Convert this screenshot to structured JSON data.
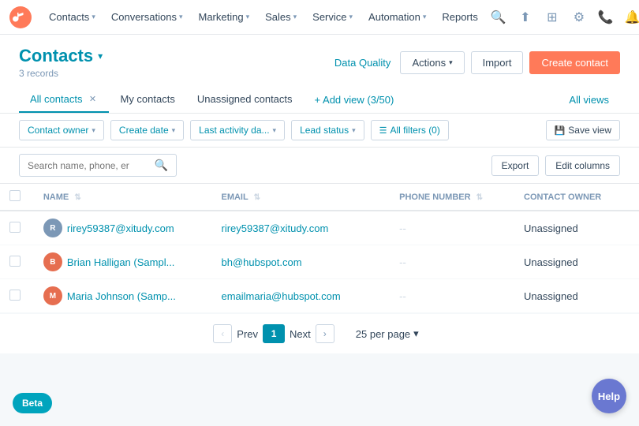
{
  "topnav": {
    "logo_alt": "HubSpot",
    "items": [
      {
        "label": "Contacts",
        "id": "contacts"
      },
      {
        "label": "Conversations",
        "id": "conversations"
      },
      {
        "label": "Marketing",
        "id": "marketing"
      },
      {
        "label": "Sales",
        "id": "sales"
      },
      {
        "label": "Service",
        "id": "service"
      },
      {
        "label": "Automation",
        "id": "automation"
      },
      {
        "label": "Reports",
        "id": "reports"
      }
    ],
    "icons": [
      "search",
      "upgrade",
      "apps",
      "settings",
      "calls",
      "notifications"
    ]
  },
  "page": {
    "title": "Contacts",
    "records_count": "3 records",
    "data_quality_label": "Data Quality",
    "actions_label": "Actions",
    "import_label": "Import",
    "create_contact_label": "Create contact"
  },
  "tabs": [
    {
      "label": "All contacts",
      "active": true,
      "closeable": true,
      "id": "all-contacts"
    },
    {
      "label": "My contacts",
      "active": false,
      "closeable": false,
      "id": "my-contacts"
    },
    {
      "label": "Unassigned contacts",
      "active": false,
      "closeable": false,
      "id": "unassigned-contacts"
    }
  ],
  "add_view": "+ Add view (3/50)",
  "all_views": "All views",
  "filters": [
    {
      "label": "Contact owner",
      "id": "contact-owner"
    },
    {
      "label": "Create date",
      "id": "create-date"
    },
    {
      "label": "Last activity da...",
      "id": "last-activity"
    },
    {
      "label": "Lead status",
      "id": "lead-status"
    },
    {
      "label": "All filters (0)",
      "id": "all-filters",
      "icon": "filter"
    }
  ],
  "save_view_label": "Save view",
  "search": {
    "placeholder": "Search name, phone, er"
  },
  "toolbar": {
    "export_label": "Export",
    "edit_columns_label": "Edit columns"
  },
  "table": {
    "columns": [
      {
        "label": "NAME",
        "id": "name",
        "sortable": true
      },
      {
        "label": "EMAIL",
        "id": "email",
        "sortable": true
      },
      {
        "label": "PHONE NUMBER",
        "id": "phone",
        "sortable": true
      },
      {
        "label": "CONTACT OWNER",
        "id": "owner",
        "sortable": false
      }
    ],
    "rows": [
      {
        "id": 1,
        "avatar_color": "#7c98b6",
        "avatar_initials": "R",
        "name": "rirey59387@xitudy.com",
        "email": "rirey59387@xitudy.com",
        "phone": "--",
        "owner": "Unassigned"
      },
      {
        "id": 2,
        "avatar_color": "#e66e50",
        "avatar_initials": "B",
        "name": "Brian Halligan (Sampl...",
        "email": "bh@hubspot.com",
        "phone": "--",
        "owner": "Unassigned"
      },
      {
        "id": 3,
        "avatar_color": "#e66e50",
        "avatar_initials": "M",
        "name": "Maria Johnson (Samp...",
        "email": "emailmaria@hubspot.com",
        "phone": "--",
        "owner": "Unassigned"
      }
    ]
  },
  "pagination": {
    "prev_label": "Prev",
    "next_label": "Next",
    "current_page": "1",
    "per_page_label": "25 per page"
  },
  "beta_label": "Beta",
  "help_label": "Help"
}
